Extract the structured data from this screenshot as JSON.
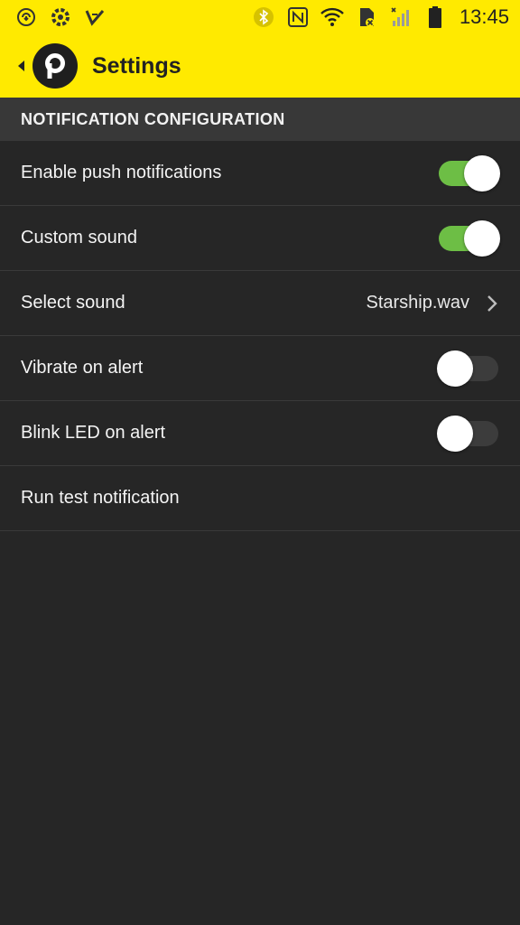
{
  "status_bar": {
    "left_icons": [
      "sync-icon",
      "settings-gear-icon",
      "app-notification-icon"
    ],
    "right_icons": [
      "bluetooth-icon",
      "nfc-icon",
      "wifi-icon",
      "sd-card-icon",
      "signal-icon",
      "battery-icon"
    ],
    "time": "13:45"
  },
  "app_bar": {
    "title": "Settings",
    "logo_letter": "p",
    "colors": {
      "background": "#FFEA00",
      "text": "#222222"
    }
  },
  "section": {
    "title": "NOTIFICATION CONFIGURATION"
  },
  "settings": [
    {
      "label": "Enable push notifications",
      "type": "toggle",
      "on": true
    },
    {
      "label": "Custom sound",
      "type": "toggle",
      "on": true
    },
    {
      "label": "Select sound",
      "type": "select",
      "value": "Starship.wav"
    },
    {
      "label": "Vibrate on alert",
      "type": "toggle",
      "on": false
    },
    {
      "label": "Blink LED on alert",
      "type": "toggle",
      "on": false
    },
    {
      "label": "Run test notification",
      "type": "action"
    }
  ],
  "colors": {
    "toggle_on": "#6DBE45",
    "toggle_off": "#3C3C3C",
    "background": "#262626",
    "section_header": "#383838"
  }
}
